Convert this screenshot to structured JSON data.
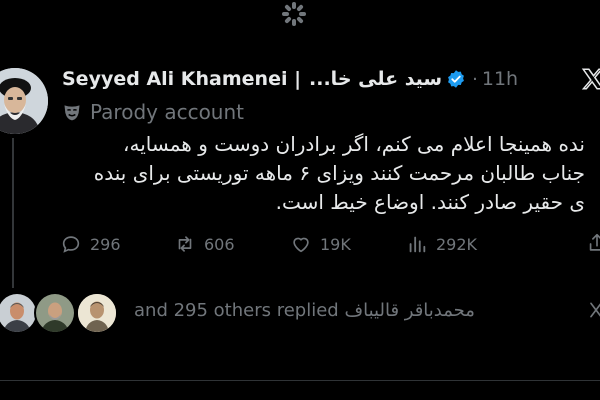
{
  "post": {
    "author_name": "Seyyed Ali Khamenei |",
    "author_name_fa": "سید علی خا...",
    "time": "11h",
    "badge": "Parody account",
    "text_lines": [
      "نده همینجا اعلام می کنم، اگر برادران دوست و همسایه،",
      "جناب طالبان مرحمت کنند ویزای ۶ ماهه توریستی برای بنده",
      "ی حقیر صادر کنند. اوضاع خیط است."
    ]
  },
  "actions": {
    "replies": "296",
    "reposts": "606",
    "likes": "19K",
    "views": "292K"
  },
  "replied": {
    "text_en": "and 295 others replied",
    "name_fa": "محمدباقر قالیباف"
  },
  "colors": {
    "background": "#000000",
    "text": "#e7e9ea",
    "muted": "#71767b",
    "verified": "#1d9bf0"
  },
  "icons": [
    "loading-spinner-icon",
    "verified-badge-icon",
    "parody-mask-icon",
    "x-logo-icon",
    "reply-icon",
    "repost-icon",
    "like-icon",
    "views-icon",
    "share-icon",
    "more-icon"
  ]
}
